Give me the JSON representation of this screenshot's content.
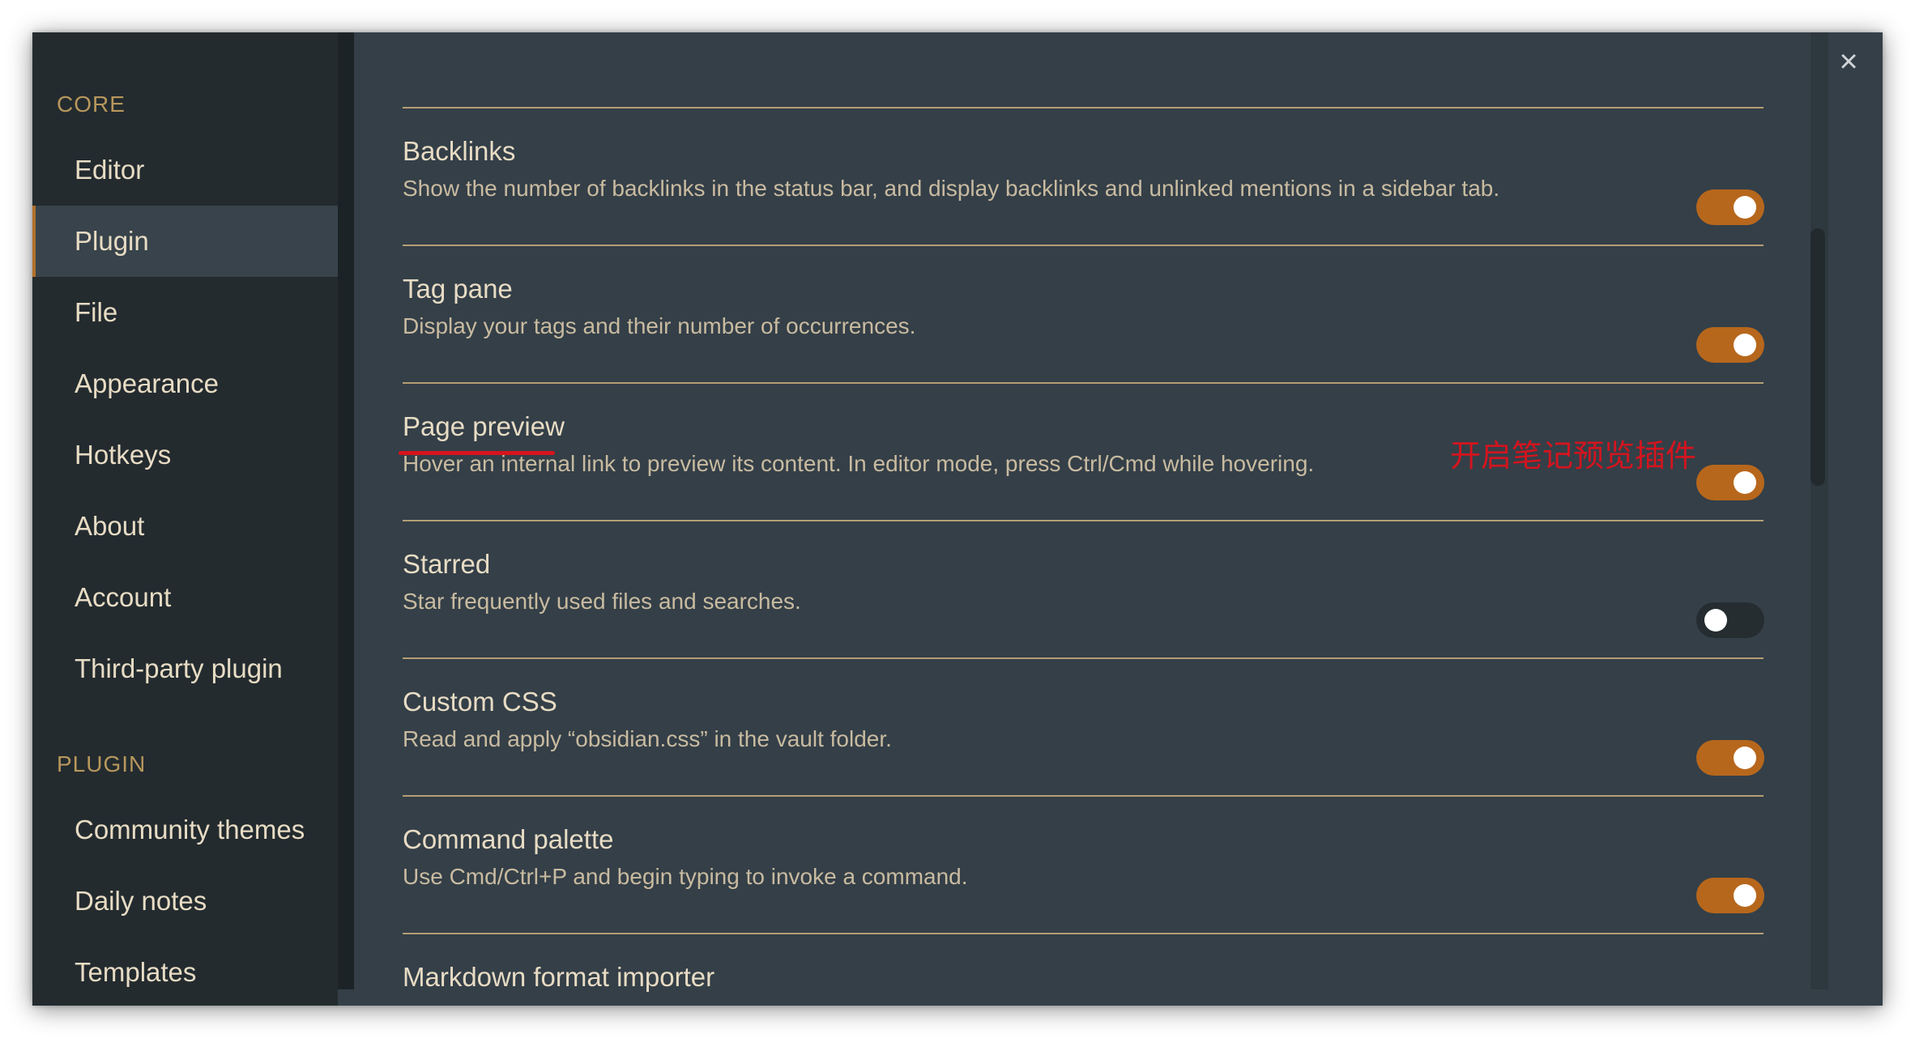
{
  "sidebar": {
    "core_label": "CORE",
    "core_items": [
      {
        "label": "Editor"
      },
      {
        "label": "Plugin"
      },
      {
        "label": "File"
      },
      {
        "label": "Appearance"
      },
      {
        "label": "Hotkeys"
      },
      {
        "label": "About"
      },
      {
        "label": "Account"
      },
      {
        "label": "Third-party plugin"
      }
    ],
    "plugin_label": "PLUGIN",
    "plugin_items": [
      {
        "label": "Community themes"
      },
      {
        "label": "Daily notes"
      },
      {
        "label": "Templates"
      }
    ]
  },
  "plugins": [
    {
      "title": "Backlinks",
      "description": "Show the number of backlinks in the status bar, and display backlinks and unlinked mentions in a sidebar tab.",
      "enabled": true
    },
    {
      "title": "Tag pane",
      "description": "Display your tags and their number of occurrences.",
      "enabled": true
    },
    {
      "title": "Page preview",
      "description": "Hover an internal link to preview its content. In editor mode, press Ctrl/Cmd while hovering.",
      "enabled": true
    },
    {
      "title": "Starred",
      "description": "Star frequently used files and searches.",
      "enabled": false
    },
    {
      "title": "Custom CSS",
      "description": "Read and apply “obsidian.css” in the vault folder.",
      "enabled": true
    },
    {
      "title": "Command palette",
      "description": "Use Cmd/Ctrl+P and begin typing to invoke a command.",
      "enabled": true
    },
    {
      "title": "Markdown format importer",
      "description": "",
      "enabled": true
    }
  ],
  "annotation": "开启笔记预览插件",
  "close_icon": "×",
  "colors": {
    "accent": "#b7671c",
    "annotation": "#d4141e",
    "background": "#343f48",
    "sidebar": "#232b2f"
  }
}
